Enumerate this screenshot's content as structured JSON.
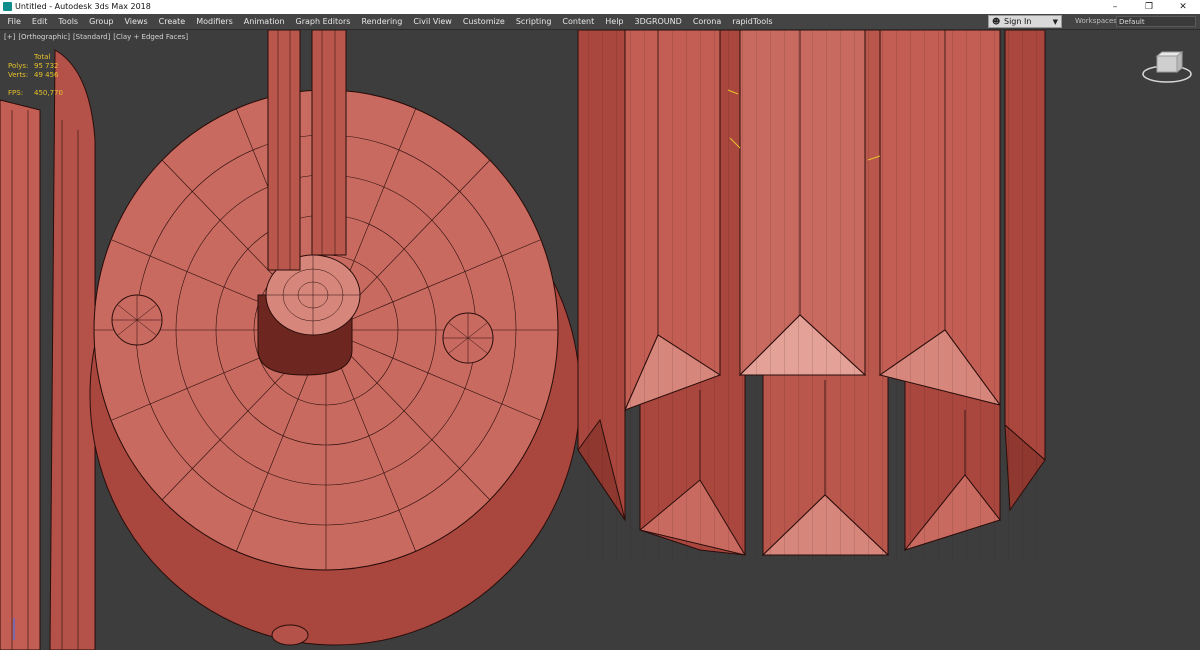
{
  "window": {
    "title": "Untitled - Autodesk 3ds Max 2018",
    "controls": {
      "minimize": "–",
      "restore": "❐",
      "close": "✕"
    }
  },
  "menu": {
    "items": [
      "File",
      "Edit",
      "Tools",
      "Group",
      "Views",
      "Create",
      "Modifiers",
      "Animation",
      "Graph Editors",
      "Rendering",
      "Civil View",
      "Customize",
      "Scripting",
      "Content",
      "Help",
      "3DGROUND",
      "Corona",
      "rapidTools"
    ],
    "sign_in": "Sign In",
    "workspaces_label": "Workspaces:",
    "workspace_value": "Default"
  },
  "viewport": {
    "labels": [
      "[+]",
      "[Orthographic]",
      "[Standard]",
      "[Clay + Edged Faces]"
    ],
    "stats": {
      "header": "Total",
      "polys_label": "Polys:",
      "polys_value": "95 732",
      "verts_label": "Verts:",
      "verts_value": "49 456",
      "fps_label": "FPS:",
      "fps_value": "450,770"
    },
    "navcube_icon": "viewcube-icon"
  },
  "colors": {
    "clay": "#c05c52",
    "wire": "#2a0d0a",
    "viewport_bg": "#3d3d3d",
    "stats_text": "#e6c02a"
  }
}
